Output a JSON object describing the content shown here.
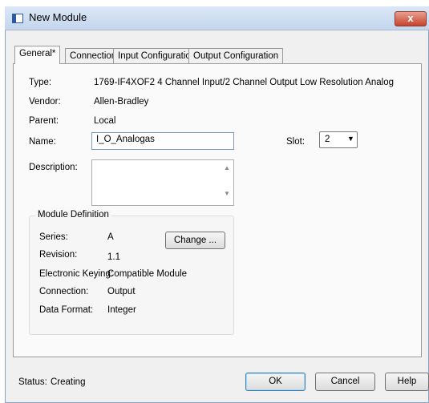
{
  "window": {
    "title": "New Module",
    "close_label": "x"
  },
  "tabs": [
    {
      "label": "General*"
    },
    {
      "label": "Connection"
    },
    {
      "label": "Input Configuration"
    },
    {
      "label": "Output Configuration"
    }
  ],
  "general": {
    "type_label": "Type:",
    "type_value": "1769-IF4XOF2 4 Channel Input/2 Channel Output Low Resolution Analog",
    "vendor_label": "Vendor:",
    "vendor_value": "Allen-Bradley",
    "parent_label": "Parent:",
    "parent_value": "Local",
    "name_label": "Name:",
    "name_value": "I_O_Analogas",
    "slot_label": "Slot:",
    "slot_value": "2",
    "description_label": "Description:",
    "description_value": ""
  },
  "module_definition": {
    "title": "Module Definition",
    "series_label": "Series:",
    "series_value": "A",
    "revision_label": "Revision:",
    "revision_value": "1.1",
    "keying_label": "Electronic Keying:",
    "keying_value": "Compatible Module",
    "connection_label": "Connection:",
    "connection_value": "Output",
    "data_format_label": "Data Format:",
    "data_format_value": "Integer",
    "change_button": "Change ..."
  },
  "footer": {
    "status_label": "Status:",
    "status_value": "Creating",
    "ok_button": "OK",
    "cancel_button": "Cancel",
    "help_button": "Help"
  }
}
